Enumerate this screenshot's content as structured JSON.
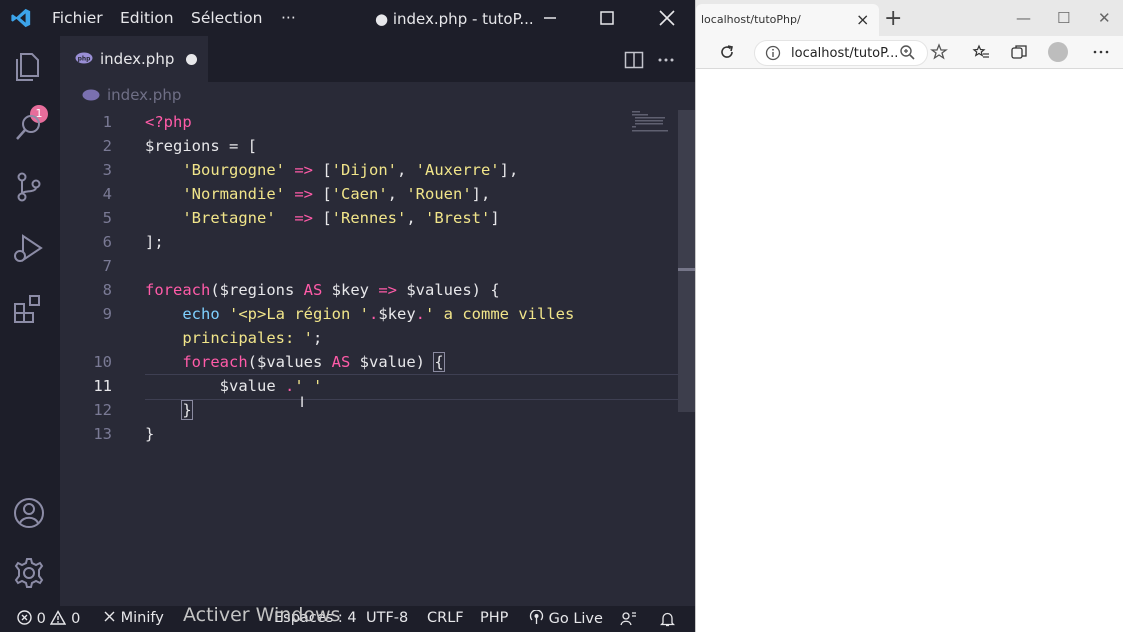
{
  "vscode": {
    "menu": [
      "Fichier",
      "Edition",
      "Sélection",
      "···"
    ],
    "window_title": "● index.php - tutoP...",
    "activity_badge": "1",
    "tab": {
      "label": "index.php",
      "modified": true
    },
    "breadcrumb": "index.php",
    "line_numbers": [
      "1",
      "2",
      "3",
      "4",
      "5",
      "6",
      "7",
      "8",
      "9",
      "",
      "10",
      "11",
      "12",
      "13"
    ],
    "active_line": "11",
    "code": {
      "l1": {
        "open": "<?php"
      },
      "l2": {
        "var": "$regions",
        "eq": " = ["
      },
      "l3": {
        "indent": "    ",
        "key": "'Bourgogne'",
        "arrow": " => ",
        "open": "[",
        "v1": "'Dijon'",
        "sep": ", ",
        "v2": "'Auxerre'",
        "close": "],"
      },
      "l4": {
        "indent": "    ",
        "key": "'Normandie'",
        "arrow": " => ",
        "open": "[",
        "v1": "'Caen'",
        "sep": ", ",
        "v2": "'Rouen'",
        "close": "],"
      },
      "l5": {
        "indent": "    ",
        "key": "'Bretagne'",
        "arrow": "  => ",
        "open": "[",
        "v1": "'Rennes'",
        "sep": ", ",
        "v2": "'Brest'",
        "close": "]"
      },
      "l6": {
        "text": "];"
      },
      "l8": {
        "kw": "foreach",
        "p1": "($regions ",
        "as": "AS",
        "p2": " $key ",
        "arrow": "=>",
        "p3": " $values) {"
      },
      "l9": {
        "indent": "    ",
        "kw": "echo",
        "sp": " ",
        "str1": "'<p>La région '",
        "dot1": ".",
        "var": "$key",
        "dot2": ".",
        "str2": "' a comme villes"
      },
      "l9b": {
        "indent": "    ",
        "str": "principales: '",
        "end": ";"
      },
      "l10": {
        "indent": "    ",
        "kw": "foreach",
        "p1": "($values ",
        "as": "AS",
        "p2": " $value) ",
        "brace": "{"
      },
      "l11": {
        "indent": "        ",
        "var": "$value ",
        "dot": ".",
        "str": "' '"
      },
      "l12": {
        "indent": "    ",
        "brace": "}"
      },
      "l13": {
        "text": "}"
      }
    },
    "status": {
      "errors": "0",
      "warnings": "0",
      "minify": "Minify",
      "spaces": "Espaces : 4",
      "encoding": "UTF-8",
      "eol": "CRLF",
      "language": "PHP",
      "golive": "Go Live"
    },
    "colors": {
      "bg": "#292a37",
      "chrome": "#1d1e29",
      "keyword": "#ff5ba8",
      "string": "#f1e58a",
      "function": "#7fd0ff",
      "badge": "#e76d9b"
    }
  },
  "browser": {
    "tab_title": "localhost/tutoPhp/",
    "url": "localhost/tutoP..."
  },
  "os_watermark": "Activer Windows"
}
